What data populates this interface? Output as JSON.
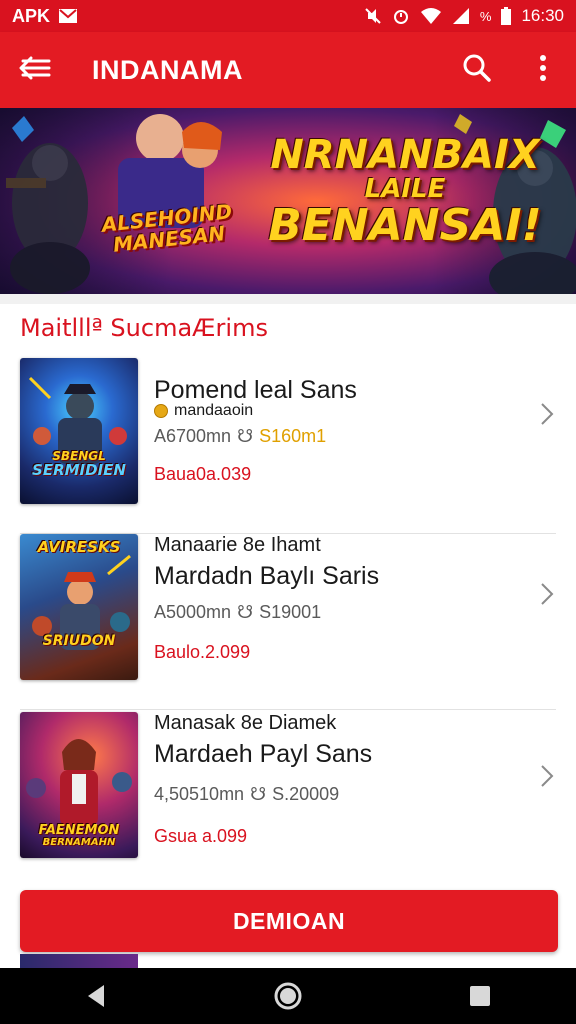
{
  "status_bar": {
    "left_text": "APK",
    "time": "16:30",
    "battery_text": "%",
    "icons": [
      "mail-icon",
      "mute-icon",
      "alarm-icon",
      "wifi-icon",
      "signal-icon",
      "battery-icon"
    ]
  },
  "app_bar": {
    "title": "INDANAMA",
    "icons": [
      "menu-icon",
      "search-icon",
      "more-vert-icon"
    ]
  },
  "banner": {
    "headline_line1": "NRNANBAIX",
    "headline_line2": "LAILE",
    "headline_line3": "BENANSAI!",
    "logo_line1": "ALSEHOIND",
    "logo_line2": "MANESAN"
  },
  "section": {
    "title": "Maitlllª SucmaÆrims"
  },
  "items": [
    {
      "title": "Pomend leal Sans",
      "subtitle": "mandaaoin",
      "meta_size": "A6700mn",
      "meta_accent": "S160m1",
      "price": "Baua0a.039",
      "thumb_text_1": "SBENGL",
      "thumb_text_2": "SERMIDIEN"
    },
    {
      "subtitle": "Manaarie 8e Ihamt",
      "title": "Mardadn Baylı Saris",
      "meta_size": "A5000mn",
      "meta_accent": "S19001",
      "price": "Baulo.2.099",
      "thumb_text_1": "AVIRESKS",
      "thumb_text_2": "SRIUDON"
    },
    {
      "subtitle": "Manasak 8e Diamek",
      "title": "Mardaeh Payl Sans",
      "meta_size": "4,50510mn",
      "meta_accent": "S.20009",
      "price": "Gsua a.099",
      "thumb_text_1": "FAENEMON",
      "thumb_text_2": "BERNAMAHN"
    }
  ],
  "download_button": {
    "label": "DEMIOAN"
  },
  "colors": {
    "primary": "#e31b23",
    "status": "#d9121f",
    "accent": "#e0a000"
  }
}
